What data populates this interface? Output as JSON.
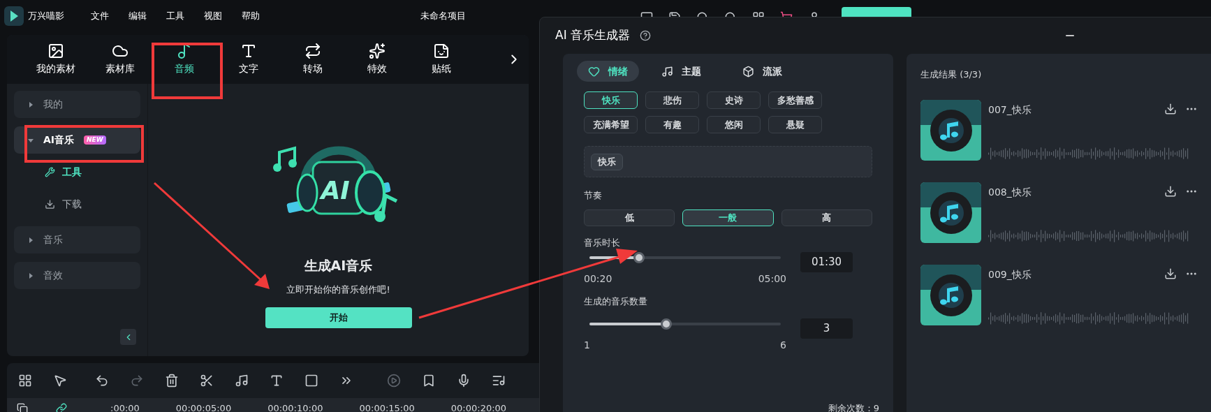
{
  "app": {
    "name": "万兴喵影",
    "menu": [
      "文件",
      "编辑",
      "工具",
      "视图",
      "帮助"
    ],
    "project": "未命名项目"
  },
  "media_tabs": [
    {
      "label": "我的素材",
      "selected": false
    },
    {
      "label": "素材库",
      "selected": false
    },
    {
      "label": "音频",
      "selected": true
    },
    {
      "label": "文字",
      "selected": false
    },
    {
      "label": "转场",
      "selected": false
    },
    {
      "label": "特效",
      "selected": false
    },
    {
      "label": "贴纸",
      "selected": false
    }
  ],
  "sidebar": [
    {
      "label": "我的",
      "expanded": false,
      "selected": false
    },
    {
      "label": "AI音乐",
      "expanded": true,
      "selected": true,
      "badge": "NEW",
      "children": [
        {
          "label": "工具",
          "selected": true
        },
        {
          "label": "下载",
          "selected": false
        }
      ]
    },
    {
      "label": "音乐",
      "expanded": false,
      "selected": false
    },
    {
      "label": "音效",
      "expanded": false,
      "selected": false
    }
  ],
  "promo": {
    "art_label": "AI",
    "title": "生成AI音乐",
    "subtitle": "立即开始你的音乐创作吧!",
    "button": "开始"
  },
  "timeline": {
    "ruler": [
      ":00:00",
      "00:00:05:00",
      "00:00:10:00",
      "00:00:15:00",
      "00:00:20:00"
    ]
  },
  "dialog": {
    "title": "AI 音乐生成器",
    "tabs": [
      {
        "label": "情绪",
        "selected": true
      },
      {
        "label": "主题",
        "selected": false
      },
      {
        "label": "流派",
        "selected": false
      }
    ],
    "moods": [
      {
        "label": "快乐",
        "selected": true
      },
      {
        "label": "悲伤",
        "selected": false
      },
      {
        "label": "史诗",
        "selected": false
      },
      {
        "label": "多愁善感",
        "selected": false
      },
      {
        "label": "充满希望",
        "selected": false
      },
      {
        "label": "有趣",
        "selected": false
      },
      {
        "label": "悠闲",
        "selected": false
      },
      {
        "label": "悬疑",
        "selected": false
      }
    ],
    "chosen": [
      "快乐"
    ],
    "tempo": {
      "label": "节奏",
      "options": [
        {
          "label": "低",
          "selected": false
        },
        {
          "label": "一般",
          "selected": true
        },
        {
          "label": "高",
          "selected": false
        }
      ]
    },
    "duration": {
      "label": "音乐时长",
      "level": 0.26,
      "min": "00:20",
      "max": "05:00",
      "value": "01:30"
    },
    "count": {
      "label": "生成的音乐数量",
      "level": 0.4,
      "min": "1",
      "max": "6",
      "value": "3"
    },
    "remaining": "剩余次数：9",
    "results": {
      "title": "生成结果 (3/3)",
      "items": [
        {
          "name": "007_快乐"
        },
        {
          "name": "008_快乐"
        },
        {
          "name": "009_快乐"
        }
      ]
    }
  }
}
